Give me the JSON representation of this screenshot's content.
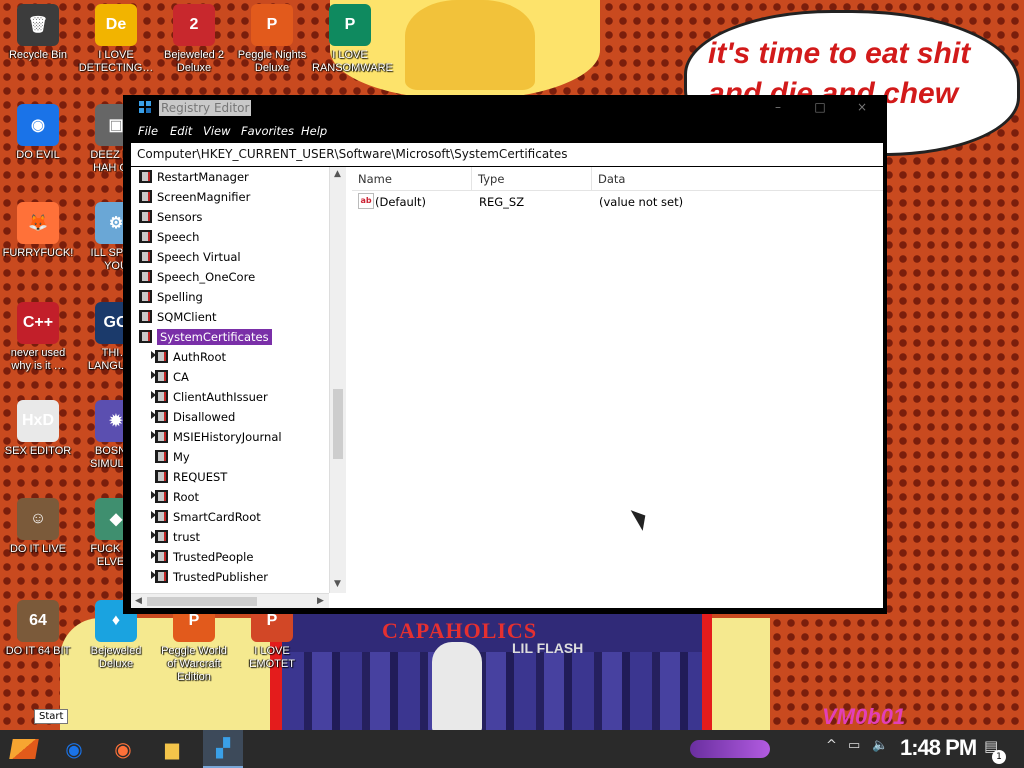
{
  "wallpaper": {
    "speech_bubble": "it's time to eat shit\nand die and chew\nw",
    "album_title": "CAPAHOLICS",
    "album_subtitle": "LIL FLASH",
    "watermark": "VM0b01"
  },
  "desktop_icons": [
    {
      "label": "Recycle Bin",
      "icon": "recycle-bin-icon",
      "color": "#3c3c3c",
      "glyph": "🗑"
    },
    {
      "label": "I LOVE DETECTING…",
      "icon": "die-icon",
      "color": "#f2b400",
      "glyph": "De"
    },
    {
      "label": "Bejeweled 2 Deluxe",
      "icon": "bejeweled2-icon",
      "color": "#c8282d",
      "glyph": "2"
    },
    {
      "label": "Peggle Nights Deluxe",
      "icon": "peggle-nights-icon",
      "color": "#e25a1c",
      "glyph": "P"
    },
    {
      "label": "I LOVE RANSOMWARE",
      "icon": "publisher-icon",
      "color": "#0f8a5f",
      "glyph": "P"
    },
    {
      "label": "DO EVIL",
      "icon": "chrome-icon",
      "color": "#1a73e8",
      "glyph": "◉"
    },
    {
      "label": "DEEZ N… HAH G…",
      "icon": "generic-app-icon",
      "color": "#666666",
      "glyph": "▣"
    },
    {
      "label": "FURRYFUCK!",
      "icon": "firefox-icon",
      "color": "#ff7139",
      "glyph": "🦊"
    },
    {
      "label": "ILL SPY… YOU",
      "icon": "spy-icon",
      "color": "#6aa7d6",
      "glyph": "⚙"
    },
    {
      "label": "never used why is it …",
      "icon": "devcpp-icon",
      "color": "#c21f2a",
      "glyph": "C++"
    },
    {
      "label": "THI… LANGUA…",
      "icon": "go-icon",
      "color": "#1b3a6b",
      "glyph": "GO"
    },
    {
      "label": "SEX EDITOR",
      "icon": "hxd-icon",
      "color": "#e9e9e9",
      "glyph": "HxD"
    },
    {
      "label": "BOSN… SIMULA…",
      "icon": "bosnia-icon",
      "color": "#5b4fb0",
      "glyph": "✹"
    },
    {
      "label": "DO IT LIVE",
      "icon": "portrait-icon",
      "color": "#7b5a3a",
      "glyph": "☺"
    },
    {
      "label": "FUCK S… ELVE…",
      "icon": "elves-icon",
      "color": "#3f8f6f",
      "glyph": "◆"
    },
    {
      "label": "DO IT 64 BIT",
      "icon": "portrait-64-icon",
      "color": "#7b5a3a",
      "glyph": "64"
    },
    {
      "label": "Bejeweled Deluxe",
      "icon": "bejeweled-icon",
      "color": "#1aa3e0",
      "glyph": "♦"
    },
    {
      "label": "Peggle World of Warcraft Edition",
      "icon": "peggle-wow-icon",
      "color": "#e25a1c",
      "glyph": "P"
    },
    {
      "label": "I LOVE EMOTET",
      "icon": "powerpoint-icon",
      "color": "#d24726",
      "glyph": "P"
    }
  ],
  "regedit": {
    "title": "Registry Editor",
    "controls": {
      "minimize": "–",
      "maximize": "□",
      "close": "×"
    },
    "menu": [
      "File",
      "Edit",
      "View",
      "Favorites",
      "Help"
    ],
    "address": "Computer\\HKEY_CURRENT_USER\\Software\\Microsoft\\SystemCertificates",
    "tree": [
      {
        "label": "RestartManager",
        "level": 0,
        "expand": false
      },
      {
        "label": "ScreenMagnifier",
        "level": 0,
        "expand": false
      },
      {
        "label": "Sensors",
        "level": 0,
        "expand": false
      },
      {
        "label": "Speech",
        "level": 0,
        "expand": false
      },
      {
        "label": "Speech Virtual",
        "level": 0,
        "expand": false
      },
      {
        "label": "Speech_OneCore",
        "level": 0,
        "expand": false
      },
      {
        "label": "Spelling",
        "level": 0,
        "expand": false
      },
      {
        "label": "SQMClient",
        "level": 0,
        "expand": false
      },
      {
        "label": "SystemCertificates",
        "level": 0,
        "expand": false,
        "selected": true
      },
      {
        "label": "AuthRoot",
        "level": 1,
        "expand": true
      },
      {
        "label": "CA",
        "level": 1,
        "expand": true
      },
      {
        "label": "ClientAuthIssuer",
        "level": 1,
        "expand": true
      },
      {
        "label": "Disallowed",
        "level": 1,
        "expand": true
      },
      {
        "label": "MSIEHistoryJournal",
        "level": 1,
        "expand": true
      },
      {
        "label": "My",
        "level": 1,
        "expand": false
      },
      {
        "label": "REQUEST",
        "level": 1,
        "expand": false
      },
      {
        "label": "Root",
        "level": 1,
        "expand": true
      },
      {
        "label": "SmartCardRoot",
        "level": 1,
        "expand": true
      },
      {
        "label": "trust",
        "level": 1,
        "expand": true
      },
      {
        "label": "TrustedPeople",
        "level": 1,
        "expand": true
      },
      {
        "label": "TrustedPublisher",
        "level": 1,
        "expand": true
      }
    ],
    "columns": [
      "Name",
      "Type",
      "Data"
    ],
    "values": [
      {
        "name": "(Default)",
        "type": "REG_SZ",
        "data": "(value not set)",
        "icon": "string-value-icon",
        "icon_glyph": "ab"
      }
    ]
  },
  "start_tooltip": "Start",
  "taskbar": {
    "buttons": [
      {
        "name": "start-button",
        "icon": "start-icon"
      },
      {
        "name": "chrome-taskbar-button",
        "icon": "chrome-icon",
        "glyph": "◉",
        "color": "#1a73e8"
      },
      {
        "name": "firefox-taskbar-button",
        "icon": "firefox-icon",
        "glyph": "◉",
        "color": "#ff7139"
      },
      {
        "name": "explorer-taskbar-button",
        "icon": "folder-icon",
        "glyph": "▆",
        "color": "#f3c44a"
      },
      {
        "name": "regedit-taskbar-button",
        "icon": "regedit-icon",
        "glyph": "▞",
        "color": "#3aa0e8",
        "active": true
      }
    ],
    "clock": "1:48 PM",
    "notifications_count": "1"
  }
}
